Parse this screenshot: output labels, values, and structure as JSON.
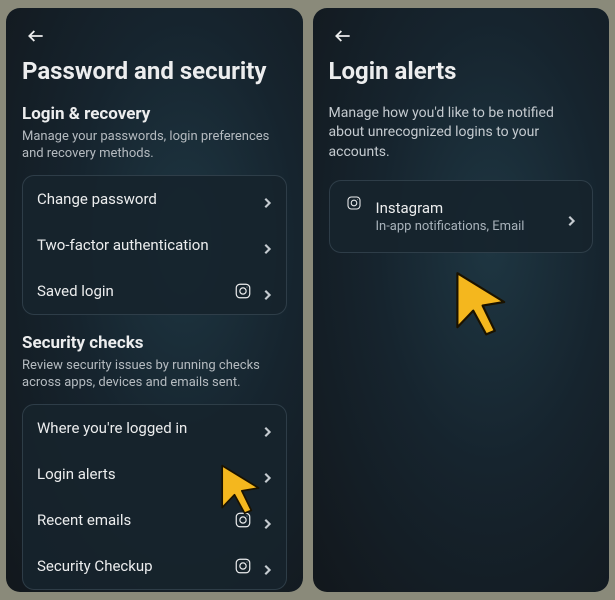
{
  "left": {
    "title": "Password and security",
    "section1": {
      "heading": "Login & recovery",
      "desc": "Manage your passwords, login preferences and recovery methods.",
      "items": [
        {
          "label": "Change password",
          "has_ig": false
        },
        {
          "label": "Two-factor authentication",
          "has_ig": false
        },
        {
          "label": "Saved login",
          "has_ig": true
        }
      ]
    },
    "section2": {
      "heading": "Security checks",
      "desc": "Review security issues by running checks across apps, devices and emails sent.",
      "items": [
        {
          "label": "Where you're logged in",
          "has_ig": false
        },
        {
          "label": "Login alerts",
          "has_ig": false
        },
        {
          "label": "Recent emails",
          "has_ig": true
        },
        {
          "label": "Security Checkup",
          "has_ig": true
        }
      ]
    }
  },
  "right": {
    "title": "Login alerts",
    "desc": "Manage how you'd like to be notified about unrecognized logins to your accounts.",
    "account": {
      "name": "Instagram",
      "sub": "In-app notifications, Email"
    }
  }
}
